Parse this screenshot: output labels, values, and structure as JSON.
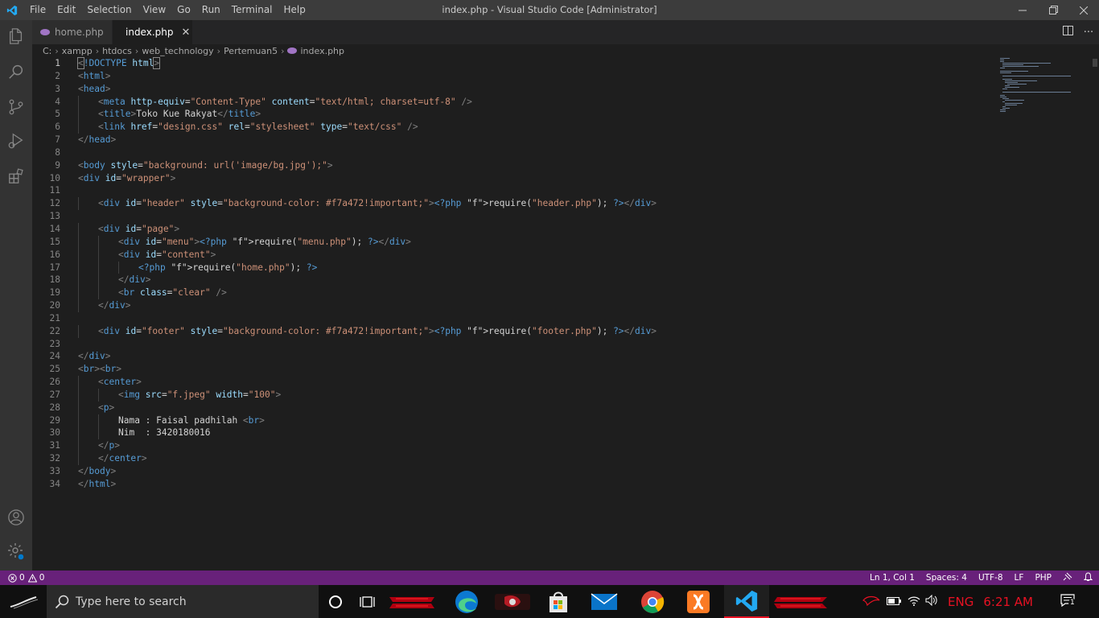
{
  "titlebar": {
    "menu": [
      "File",
      "Edit",
      "Selection",
      "View",
      "Go",
      "Run",
      "Terminal",
      "Help"
    ],
    "title": "index.php - Visual Studio Code [Administrator]"
  },
  "tabs": [
    {
      "label": "home.php",
      "active": false
    },
    {
      "label": "index.php",
      "active": true
    }
  ],
  "breadcrumb": [
    "C:",
    "xampp",
    "htdocs",
    "web_technology",
    "Pertemuan5",
    "index.php"
  ],
  "editor": {
    "lines": [
      "<!DOCTYPE html>",
      "<html>",
      "<head>",
      "    <meta http-equiv=\"Content-Type\" content=\"text/html; charset=utf-8\" />",
      "    <title>Toko Kue Rakyat</title>",
      "    <link href=\"design.css\" rel=\"stylesheet\" type=\"text/css\" />",
      "</head>",
      "",
      "<body style=\"background: url('image/bg.jpg');\">",
      "<div id=\"wrapper\">",
      "",
      "    <div id=\"header\" style=\"background-color: #f7a472!important;\"><?php require(\"header.php\"); ?></div>",
      "",
      "    <div id=\"page\">",
      "        <div id=\"menu\"><?php require(\"menu.php\"); ?></div>",
      "        <div id=\"content\">",
      "            <?php require(\"home.php\"); ?>",
      "        </div>",
      "        <br class=\"clear\" />",
      "    </div>",
      "",
      "    <div id=\"footer\" style=\"background-color: #f7a472!important;\"><?php require(\"footer.php\"); ?></div>",
      "",
      "</div>",
      "<br><br>",
      "    <center>",
      "        <img src=\"f.jpeg\" width=\"100\">",
      "    <p>",
      "        Nama : Faisal padhilah <br>",
      "        Nim  : 3420180016",
      "    </p>",
      "    </center>",
      "</body>",
      "</html>"
    ]
  },
  "statusbar": {
    "errors": "0",
    "warnings": "0",
    "position": "Ln 1, Col 1",
    "spaces": "Spaces: 4",
    "encoding": "UTF-8",
    "eol": "LF",
    "language": "PHP"
  },
  "taskbar": {
    "search_placeholder": "Type here to search",
    "lang": "ENG",
    "time": "6:21 AM",
    "notifications": "1"
  }
}
